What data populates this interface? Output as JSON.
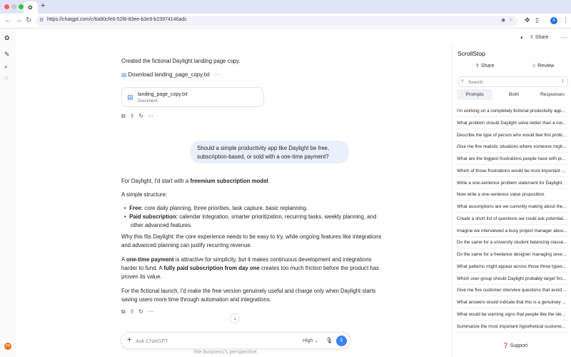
{
  "browser": {
    "url": "https://chatgpt.com/c/6a80cfe6-52f8-83ee-b3e9-b23974146adc",
    "new_tab_label": "+",
    "profile_initial": "A"
  },
  "header": {
    "share_label": "Share",
    "more_label": "···"
  },
  "sidebar": {
    "avatar_initial": "PR"
  },
  "chat": {
    "intro": "Created the fictional Daylight landing page copy.",
    "download_label": "Download landing_page_copy.txt",
    "download_more": "···",
    "file": {
      "name": "landing_page_copy.txt",
      "type": "Document"
    },
    "user_message": "Should a simple productivity app like Daylight be free, subscription-based, or sold with a one-time payment?",
    "answer": {
      "p1_pre": "For Daylight, I'd start with a ",
      "p1_bold": "freemium subscription model",
      "p1_post": ".",
      "p2": "A simple structure:",
      "b1_bold": "Free:",
      "b1_text": " core daily planning, three priorities, task capture, basic replanning.",
      "b2_bold": "Paid subscription:",
      "b2_text": " calendar integration, smarter prioritization, recurring tasks, weekly planning, and",
      "b2_cont": "other advanced features.",
      "p3_l1": "Why this fits Daylight: the core experience needs to be easy to try, while ongoing features like integrations",
      "p3_l2": "and advanced planning can justify recurring revenue.",
      "p4_l1_pre": "A ",
      "p4_l1_bold": "one-time payment",
      "p4_l1_post": " is attractive for simplicity, but it makes continuous development and integrations",
      "p4_l2_pre": "harder to fund. A ",
      "p4_l2_bold": "fully paid subscription from day one",
      "p4_l2_post": " creates too much friction before the product has",
      "p4_l3": "proven its value.",
      "p5_l1": "For the fictional launch, I'd make the free version genuinely useful and charge only when Daylight starts",
      "p5_l2": "saving users more time through automation and integrations."
    },
    "composer": {
      "placeholder": "Ask ChatGPT",
      "model_label": "High"
    },
    "overflow_text": "the business's perspective."
  },
  "scrollstop": {
    "title": "ScrollStop",
    "share_label": "Share",
    "review_label": "Review",
    "search_placeholder": "Search",
    "tabs": [
      "Prompts",
      "Both",
      "Responses"
    ],
    "items": [
      "I'm working on a completely fictional productivity app...",
      "What problem should Daylight solve better than a nor...",
      "Describe the type of person who would feel this probl...",
      "Give me five realistic situations where someone migh...",
      "What are the biggest frustrations people have with pr...",
      "Which of those frustrations would be most important ...",
      "Write a one-sentence problem statement for Daylight.",
      "Now write a one-sentence value proposition.",
      "What assumptions are we currently making about the...",
      "Create a short list of questions we could ask potential...",
      "Imagine we interviewed a busy project manager abou...",
      "Do the same for a university student balancing classe...",
      "Do the same for a freelance designer managing sever...",
      "What patterns might appear across those three types...",
      "Which user group should Daylight probably target firs...",
      "Give me five customer interview questions that avoid ...",
      "What answers would indicate that this is a genuinely ...",
      "What would be warning signs that people like the ide...",
      "Summarize the most important hypothetical custome..."
    ],
    "support_label": "Support"
  },
  "colors": {
    "accent": "#3b82f6",
    "tabbar": "#dfe5f7",
    "bubble": "#e8f0fb"
  }
}
